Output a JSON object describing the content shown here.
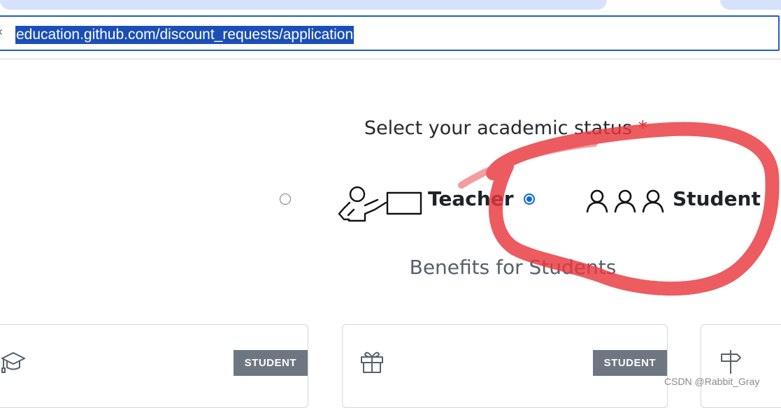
{
  "browser": {
    "url": "education.github.com/discount_requests/application"
  },
  "form": {
    "status_label": "Select your academic status",
    "required_marker": "*",
    "options": [
      {
        "label": "Teacher",
        "selected": false
      },
      {
        "label": "Student",
        "selected": true
      }
    ],
    "benefits_title": "Benefits for Students"
  },
  "cards": [
    {
      "icon": "graduation-cap-icon",
      "badge": "STUDENT"
    },
    {
      "icon": "gift-icon",
      "badge": "STUDENT"
    },
    {
      "icon": "signpost-icon",
      "badge": ""
    }
  ],
  "watermark": "CSDN @Rabbit_Gray",
  "colors": {
    "accent": "#0969da",
    "address_border": "#1f5fbf",
    "url_highlight": "#1b4fb8",
    "annotation": "#e8383d",
    "badge_bg": "#6e7781"
  }
}
